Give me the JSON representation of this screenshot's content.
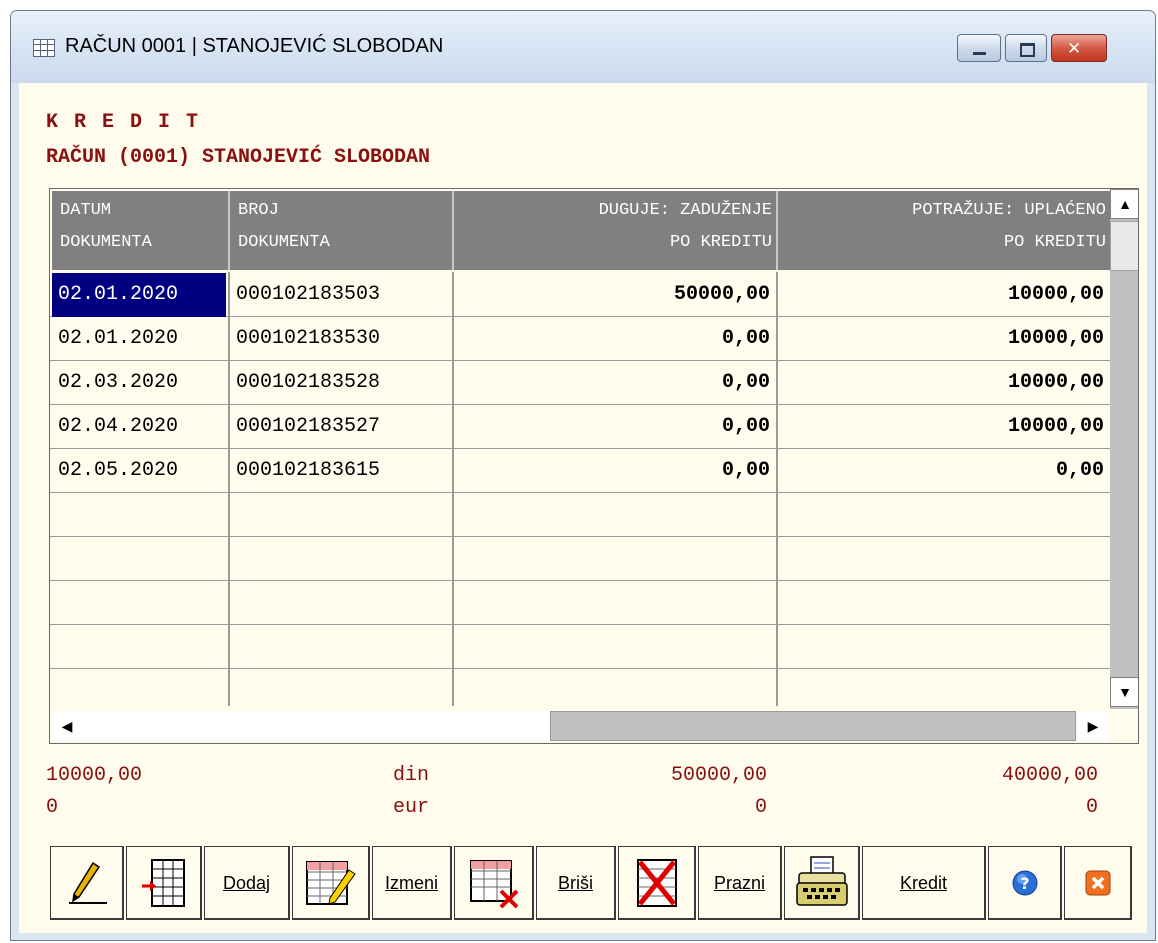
{
  "window": {
    "title": "RAČUN 0001 | STANOJEVIĆ SLOBODAN",
    "icon": "table-icon"
  },
  "heading": {
    "line1": "K R E D I T",
    "line2": "RAČUN (0001) STANOJEVIĆ SLOBODAN"
  },
  "table": {
    "columns": [
      {
        "line1": "DATUM",
        "line2": "DOKUMENTA"
      },
      {
        "line1": "BROJ",
        "line2": "DOKUMENTA"
      },
      {
        "line1": "DUGUJE: ZADUŽENJE",
        "line2": "PO KREDITU"
      },
      {
        "line1": "POTRAŽUJE: UPLAĆENO",
        "line2": "PO KREDITU"
      }
    ],
    "rows": [
      {
        "date": "02.01.2020",
        "doc": "000102183503",
        "debit": "50000,00",
        "credit": "10000,00"
      },
      {
        "date": "02.01.2020",
        "doc": "000102183530",
        "debit": "0,00",
        "credit": "10000,00"
      },
      {
        "date": "02.03.2020",
        "doc": "000102183528",
        "debit": "0,00",
        "credit": "10000,00"
      },
      {
        "date": "02.04.2020",
        "doc": "000102183527",
        "debit": "0,00",
        "credit": "10000,00"
      },
      {
        "date": "02.05.2020",
        "doc": "000102183615",
        "debit": "0,00",
        "credit": "0,00"
      }
    ]
  },
  "totals": {
    "din": {
      "left": "10000,00",
      "currency": "din",
      "debit": "50000,00",
      "credit": "40000,00"
    },
    "eur": {
      "left": "0",
      "currency": "eur",
      "debit": "0",
      "credit": "0"
    }
  },
  "toolbar": {
    "dodaj": "Dodaj",
    "izmeni": "Izmeni",
    "brisi": "Briši",
    "prazni": "Prazni",
    "kredit": "Kredit"
  },
  "colors": {
    "accent_text": "#8a1010",
    "header_bg": "#808080",
    "selection": "#000080",
    "client_bg": "#fffcee"
  }
}
